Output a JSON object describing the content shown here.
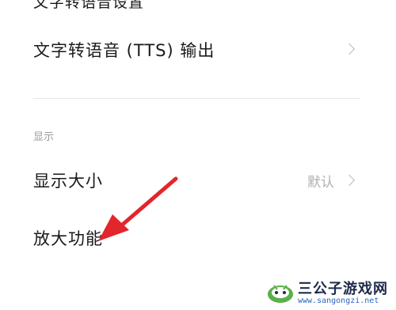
{
  "top_cut_text": "文字转语音设置",
  "rows": {
    "tts": {
      "label": "文字转语音 (TTS) 输出"
    },
    "display_size": {
      "label": "显示大小",
      "value": "默认"
    },
    "magnify": {
      "label": "放大功能"
    }
  },
  "sections": {
    "display": {
      "header": "显示"
    }
  },
  "annotation": {
    "color": "#e2262b"
  },
  "watermark": {
    "title": "三公子游戏网",
    "url": "www.sangongzi.net"
  }
}
